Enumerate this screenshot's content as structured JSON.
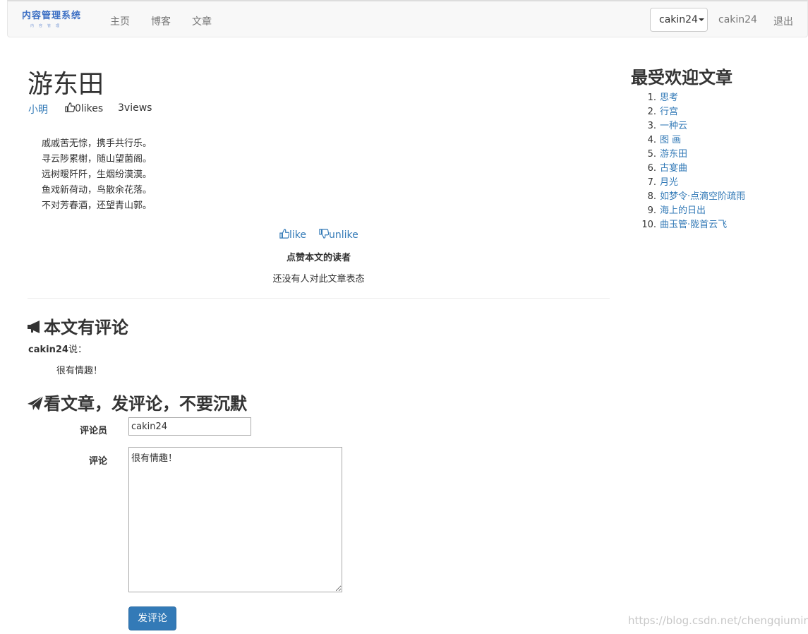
{
  "navbar": {
    "brand": "内容管理系统",
    "brand_sub": "内容管理",
    "items": [
      {
        "label": "主页"
      },
      {
        "label": "博客"
      },
      {
        "label": "文章"
      }
    ],
    "user_dropdown": "cakin24",
    "username": "cakin24",
    "logout": "退出"
  },
  "article": {
    "title": "游东田",
    "author": "小明",
    "likes": "0likes",
    "views": "3views",
    "lines": [
      "戚戚苦无悰，携手共行乐。",
      "寻云陟累榭，随山望菌阁。",
      "远树暧阡阡，生烟纷漠漠。",
      "鱼戏新荷动，鸟散余花落。",
      "不对芳春酒，还望青山郭。"
    ],
    "like_label": "like",
    "unlike_label": "unlike",
    "readers_heading": "点赞本文的读者",
    "no_readers": "还没有人对此文章表态"
  },
  "comments": {
    "heading": "本文有评论",
    "items": [
      {
        "user": "cakin24",
        "suffix": "说：",
        "text": "很有情趣！"
      }
    ]
  },
  "comment_form": {
    "heading": "看文章，发评论，不要沉默",
    "commenter_label": "评论员",
    "commenter_value": "cakin24",
    "comment_label": "评论",
    "comment_value": "很有情趣！",
    "submit_label": "发评论"
  },
  "sidebar": {
    "title": "最受欢迎文章",
    "articles": [
      {
        "num": "1.",
        "title": "思考"
      },
      {
        "num": "2.",
        "title": "行宫"
      },
      {
        "num": "3.",
        "title": "一种云"
      },
      {
        "num": "4.",
        "title": "图 画"
      },
      {
        "num": "5.",
        "title": "游东田"
      },
      {
        "num": "6.",
        "title": "古宴曲"
      },
      {
        "num": "7.",
        "title": "月光"
      },
      {
        "num": "8.",
        "title": "如梦令·点滴空阶疏雨"
      },
      {
        "num": "9.",
        "title": "海上的日出"
      },
      {
        "num": "10.",
        "title": "曲玉管·陇首云飞"
      }
    ]
  },
  "watermark": "https://blog.csdn.net/chengqiuming",
  "colors": {
    "link": "#337ab7",
    "primary_button": "#337ab7",
    "navbar_bg": "#f8f8f8"
  }
}
